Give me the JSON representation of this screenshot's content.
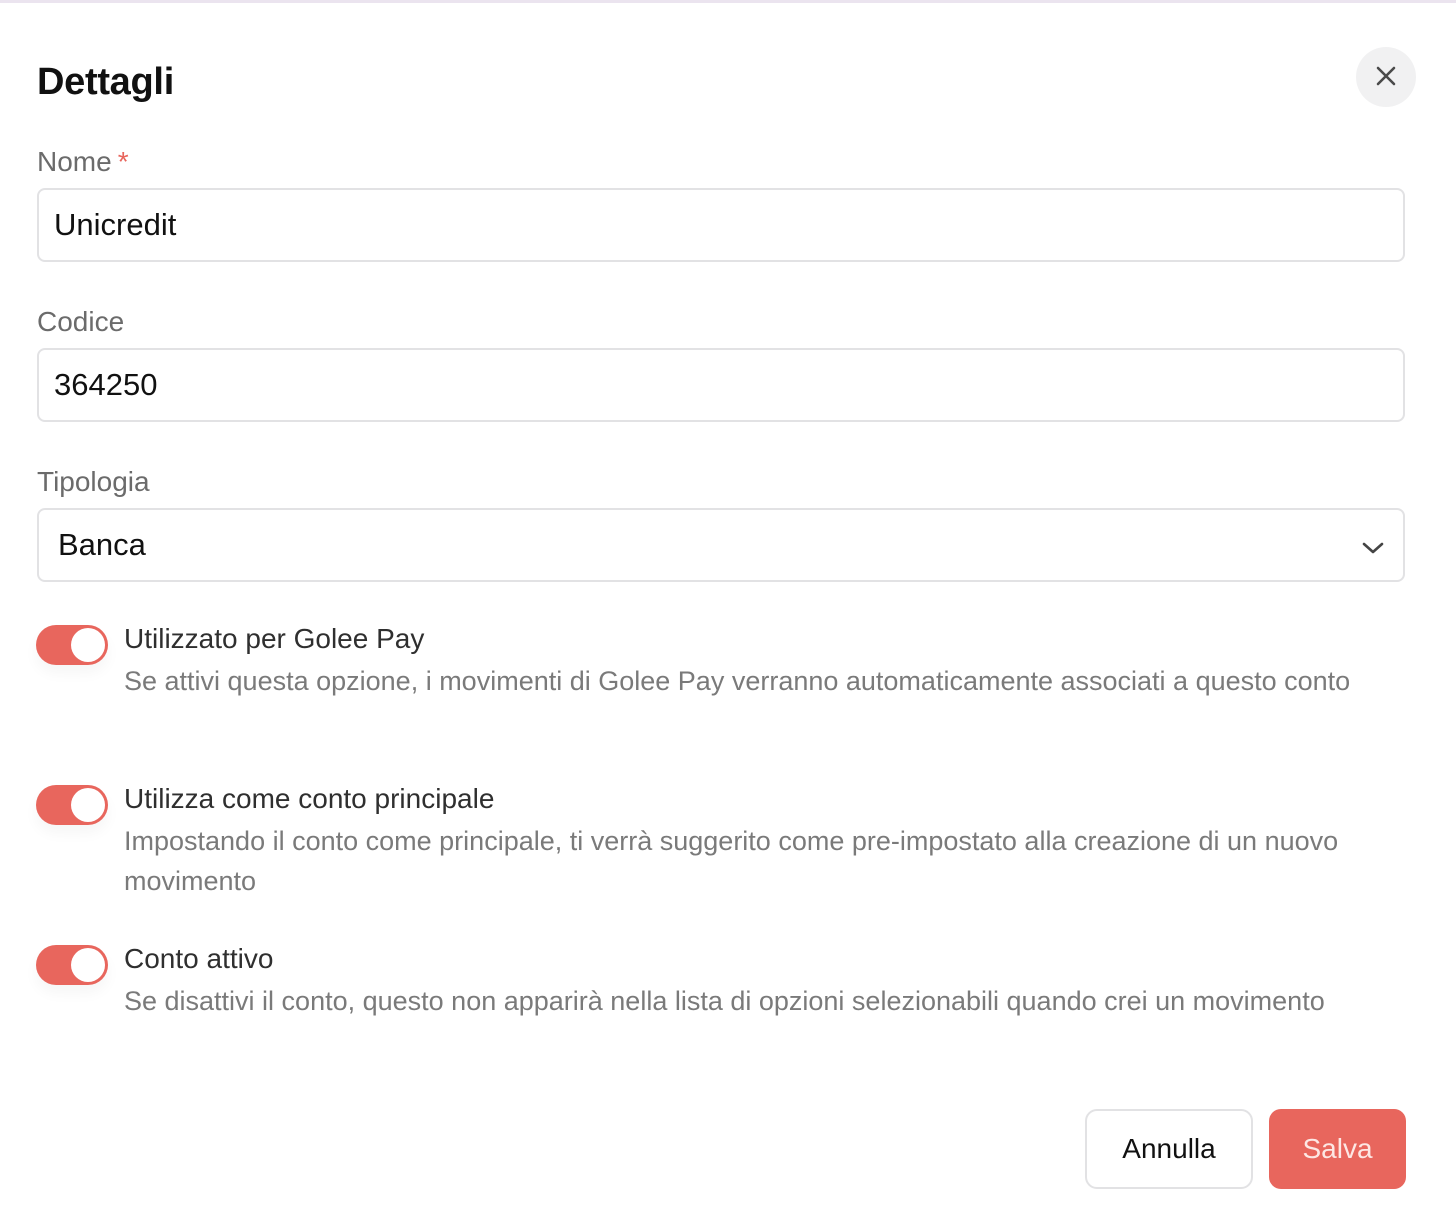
{
  "dialog": {
    "title": "Dettagli"
  },
  "fields": {
    "nome": {
      "label": "Nome",
      "required_mark": "*",
      "value": "Unicredit"
    },
    "codice": {
      "label": "Codice",
      "value": "364250"
    },
    "tipologia": {
      "label": "Tipologia",
      "selected": "Banca"
    }
  },
  "options": [
    {
      "title": "Utilizzato per Golee Pay",
      "description": "Se attivi questa opzione, i movimenti di Golee Pay verranno automaticamente associati a questo conto",
      "enabled": true
    },
    {
      "title": "Utilizza come conto principale",
      "description": "Impostando il conto come principale, ti verrà suggerito come pre-impostato alla creazione di un nuovo movimento",
      "enabled": true
    },
    {
      "title": "Conto attivo",
      "description": "Se disattivi il conto, questo non apparirà nella lista di opzioni selezionabili quando crei un movimento",
      "enabled": true
    }
  ],
  "actions": {
    "cancel_label": "Annulla",
    "save_label": "Salva"
  },
  "colors": {
    "accent": "#e8665d",
    "required": "#e8655c"
  },
  "icons": {
    "close": "close-icon",
    "dropdown": "chevron-down-icon"
  }
}
